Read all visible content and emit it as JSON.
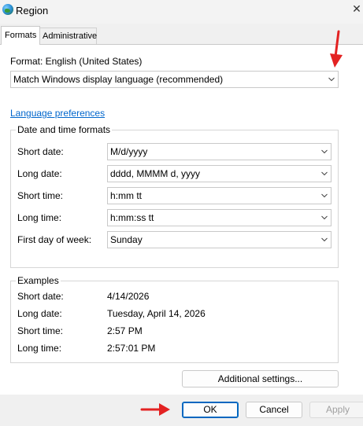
{
  "window": {
    "title": "Region",
    "close_glyph": "✕"
  },
  "tabs": [
    {
      "label": "Formats",
      "selected": true
    },
    {
      "label": "Administrative",
      "selected": false
    }
  ],
  "format": {
    "label": "Format: English (United States)",
    "dropdown_value": "Match Windows display language (recommended)"
  },
  "language_preferences_link": "Language preferences",
  "date_time_formats": {
    "legend": "Date and time formats",
    "rows": [
      {
        "label": "Short date:",
        "value": "M/d/yyyy"
      },
      {
        "label": "Long date:",
        "value": "dddd, MMMM d, yyyy"
      },
      {
        "label": "Short time:",
        "value": "h:mm tt"
      },
      {
        "label": "Long time:",
        "value": "h:mm:ss tt"
      },
      {
        "label": "First day of week:",
        "value": "Sunday"
      }
    ]
  },
  "examples": {
    "legend": "Examples",
    "rows": [
      {
        "label": "Short date:",
        "value": "4/14/2026"
      },
      {
        "label": "Long date:",
        "value": "Tuesday, April 14, 2026"
      },
      {
        "label": "Short time:",
        "value": "2:57 PM"
      },
      {
        "label": "Long time:",
        "value": "2:57:01 PM"
      }
    ]
  },
  "additional_settings_label": "Additional settings...",
  "buttons": {
    "ok": "OK",
    "cancel": "Cancel",
    "apply": "Apply"
  },
  "colors": {
    "link": "#0066cc",
    "annotation_arrow": "#e32222",
    "ok_border": "#0067c0"
  },
  "icons": {
    "app": "globe-icon",
    "close": "close-icon",
    "dropdown": "chevron-down-icon"
  }
}
